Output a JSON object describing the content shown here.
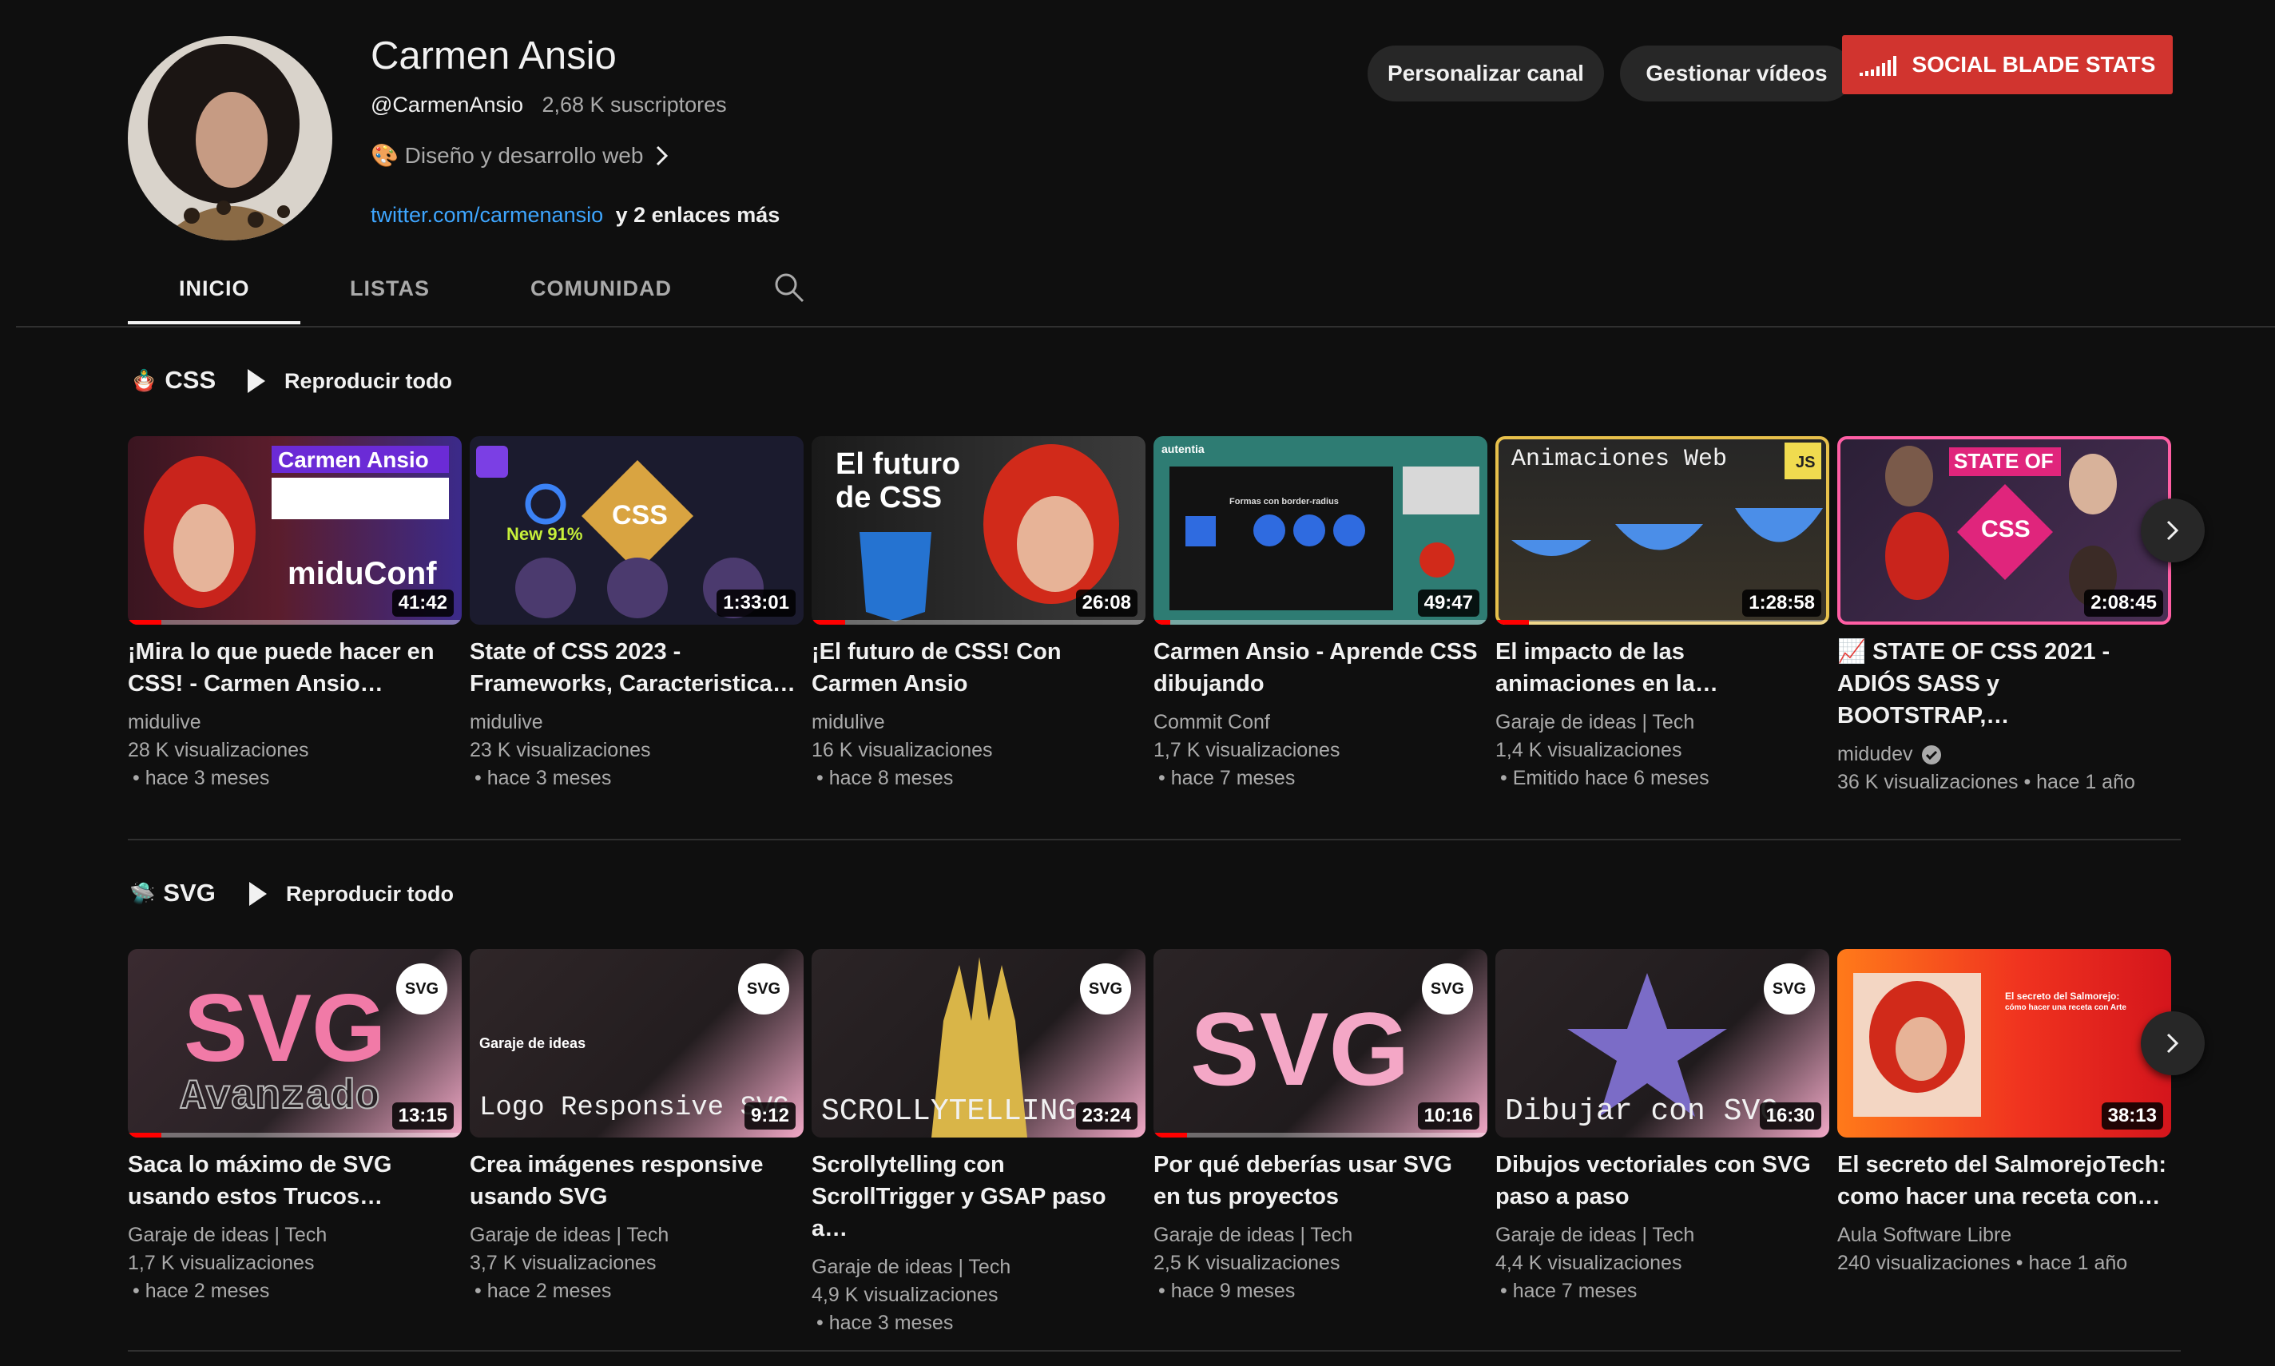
{
  "channel": {
    "name": "Carmen Ansio",
    "handle": "@CarmenAnsio",
    "subscribers": "2,68 K suscriptores",
    "description": "🎨 Diseño y desarrollo web",
    "link": "twitter.com/carmenansio",
    "more_links": "y 2 enlaces más"
  },
  "buttons": {
    "customize": "Personalizar canal",
    "manage": "Gestionar vídeos",
    "social_blade": "SOCIAL BLADE STATS"
  },
  "tabs": [
    "INICIO",
    "LISTAS",
    "COMUNIDAD"
  ],
  "colors": {
    "accent_red": "#ff0000",
    "social_blade": "#d1342f",
    "link": "#3ea6ff"
  },
  "shelves": [
    {
      "emoji": "🪆",
      "title": "CSS",
      "play_all": "Reproducir todo",
      "videos": [
        {
          "title1": "¡Mira lo que puede hacer en",
          "title2": "CSS! - Carmen Ansio…",
          "channel": "midulive",
          "views": "28 K visualizaciones",
          "time": "• hace 3 meses",
          "duration": "41:42",
          "progress": 0.1,
          "thumb_text": "Carmen Ansio",
          "thumb_text2": "miduConf"
        },
        {
          "title1": "State of CSS 2023 -",
          "title2": "Frameworks, Caracteristica…",
          "channel": "midulive",
          "views": "23 K visualizaciones",
          "time": "• hace 3 meses",
          "duration": "1:33:01",
          "progress": 0.0,
          "thumb_text": "CSS",
          "thumb_text2": "New 91%"
        },
        {
          "title1": "¡El futuro de CSS! Con",
          "title2": "Carmen Ansio",
          "channel": "midulive",
          "views": "16 K visualizaciones",
          "time": "• hace 8 meses",
          "duration": "26:08",
          "progress": 0.1,
          "thumb_text": "El futuro",
          "thumb_text2": "de CSS"
        },
        {
          "title1": "Carmen Ansio - Aprende CSS",
          "title2": "dibujando",
          "channel": "Commit Conf",
          "views": "1,7 K visualizaciones",
          "time": "• hace 7 meses",
          "duration": "49:47",
          "progress": 0.05,
          "thumb_text": "autentia",
          "thumb_text2": "Formas con border-radius"
        },
        {
          "title1": "El impacto de las",
          "title2": "animaciones en la…",
          "channel": "Garaje de ideas | Tech",
          "views": "1,4 K visualizaciones",
          "time": "• Emitido hace 6 meses",
          "duration": "1:28:58",
          "progress": 0.1,
          "thumb_text": "Animaciones Web",
          "thumb_text2": "JS"
        },
        {
          "title1": "📈 STATE OF CSS 2021 -",
          "title2": "ADIÓS SASS y BOOTSTRAP,…",
          "channel": "midudev",
          "views": "36 K visualizaciones • hace 1 año",
          "time": "",
          "duration": "2:08:45",
          "progress": 0.0,
          "thumb_text": "STATE OF",
          "thumb_text2": "CSS",
          "verified": true
        }
      ]
    },
    {
      "emoji": "🛸",
      "title": "SVG",
      "play_all": "Reproducir todo",
      "videos": [
        {
          "title1": "Saca lo máximo de SVG",
          "title2": "usando estos Trucos…",
          "channel": "Garaje de ideas | Tech",
          "views": "1,7 K visualizaciones",
          "time": "• hace 2 meses",
          "duration": "13:15",
          "progress": 0.1,
          "thumb_text": "SVG",
          "thumb_text2": "Avanzado"
        },
        {
          "title1": "Crea imágenes responsive",
          "title2": "usando SVG",
          "channel": "Garaje de ideas | Tech",
          "views": "3,7 K visualizaciones",
          "time": "• hace 2 meses",
          "duration": "9:12",
          "progress": 0.0,
          "thumb_text": "Garaje de ideas",
          "thumb_text2": "Logo Responsive SVG"
        },
        {
          "title1": "Scrollytelling con",
          "title2": "ScrollTrigger y GSAP paso a…",
          "channel": "Garaje de ideas | Tech",
          "views": "4,9 K visualizaciones",
          "time": "• hace 3 meses",
          "duration": "23:24",
          "progress": 0.0,
          "thumb_text": "SCROLLYTELLING",
          "thumb_text2": ""
        },
        {
          "title1": "Por qué deberías usar SVG",
          "title2": "en tus proyectos",
          "channel": "Garaje de ideas | Tech",
          "views": "2,5 K visualizaciones",
          "time": "• hace 9 meses",
          "duration": "10:16",
          "progress": 0.1,
          "thumb_text": "SVG",
          "thumb_text2": ""
        },
        {
          "title1": "Dibujos vectoriales con SVG",
          "title2": "paso a paso",
          "channel": "Garaje de ideas | Tech",
          "views": "4,4 K visualizaciones",
          "time": "• hace 7 meses",
          "duration": "16:30",
          "progress": 0.0,
          "thumb_text": "Dibujar con SVG",
          "thumb_text2": ""
        },
        {
          "title1": "El secreto del SalmorejoTech:",
          "title2": "como hacer una receta con…",
          "channel": "Aula Software Libre",
          "views": "240 visualizaciones • hace 1 año",
          "time": "",
          "duration": "38:13",
          "progress": 0.0,
          "thumb_text": "El secreto del Salmorejo:",
          "thumb_text2": "cómo hacer una receta con Arte"
        }
      ]
    }
  ]
}
